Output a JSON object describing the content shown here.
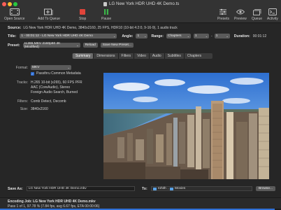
{
  "window": {
    "title": "LG New York HDR UHD 4K Demo.ts"
  },
  "toolbar": {
    "open_source": "Open Source",
    "add_to_queue": "Add To Queue",
    "stop": "Stop",
    "pause": "Pause",
    "presets": "Presets",
    "preview": "Preview",
    "queue": "Queue",
    "activity": "Activity"
  },
  "source": {
    "label": "Source:",
    "value": "LG New York HDR UHD 4K Demo, 3840x2160, 25 FPS, HDR10 (10-bit 4:2:0, 9-16-9), 1 audio track"
  },
  "title_row": {
    "label": "Title:",
    "title_value": "1 - 00:01:12 - LG New York HDR UHD 4K Demo",
    "angle_label": "Angle:",
    "angle_value": "1",
    "range_label": "Range:",
    "range_type": "Chapters",
    "range_start": "1",
    "range_sep": "-",
    "range_end": "1",
    "duration_label": "Duration:",
    "duration_value": "00:01:12"
  },
  "preset_row": {
    "label": "Preset:",
    "value": "H.265 MKV 2160p60 4K (Modified)",
    "reload": "Reload",
    "save_new": "Save New Preset..."
  },
  "tabs": [
    {
      "label": "Summary",
      "active": true
    },
    {
      "label": "Dimensions",
      "active": false
    },
    {
      "label": "Filters",
      "active": false
    },
    {
      "label": "Video",
      "active": false
    },
    {
      "label": "Audio",
      "active": false
    },
    {
      "label": "Subtitles",
      "active": false
    },
    {
      "label": "Chapters",
      "active": false
    }
  ],
  "summary": {
    "format_label": "Format:",
    "format_value": "MKV",
    "passthru_label": "Passthru Common Metadata",
    "passthru_checked": true,
    "tracks_label": "Tracks:",
    "tracks_line1": "H.265 10-bit (x265), 60 FPS PFR",
    "tracks_line2": "AAC (CoreAudio), Stereo",
    "tracks_line3": "Foreign Audio Search, Burned",
    "filters_label": "Filters:",
    "filters_value": "Comb Detect, Decomb",
    "size_label": "Size:",
    "size_value": "3840x2160"
  },
  "save_as": {
    "label": "Save As:",
    "value": "LG New York HDR UHD 4K Demo.mkv",
    "to_label": "To:",
    "path_user": "rohith",
    "path_folder": "Movies",
    "browse": "Browse..."
  },
  "status": {
    "line1": "Encoding Job: LG New York HDR UHD 4K Demo.mkv",
    "line2": "Pass 1 of 1, 97.78 % (7.84 fps, avg 6.67 fps, ETA 00:00:06)",
    "progress": 0.9778
  },
  "colors": {
    "accent": "#2f6fd6",
    "stop": "#e0443a",
    "pause": "#3cb54a",
    "background": "#262626"
  }
}
